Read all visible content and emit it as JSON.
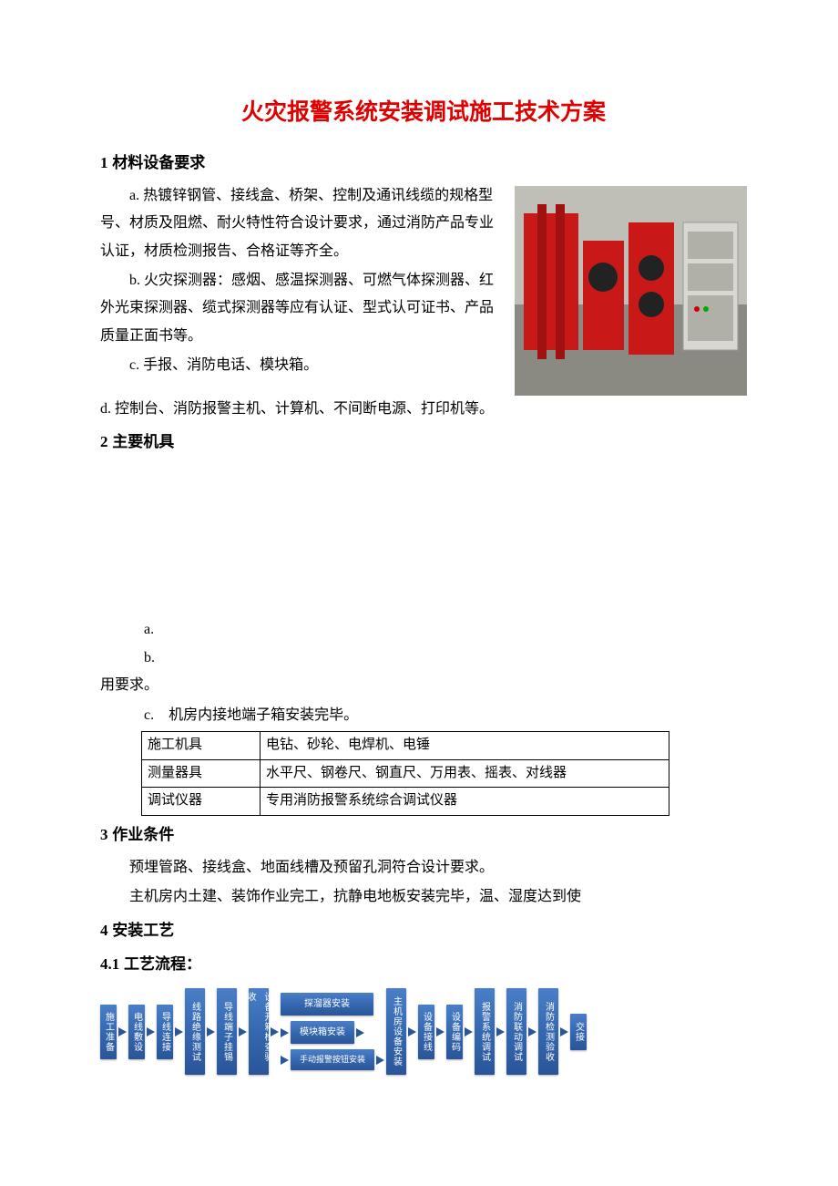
{
  "title": "火灾报警系统安装调试施工技术方案",
  "sections": {
    "s1": {
      "num": "1",
      "heading": "材料设备要求"
    },
    "s2": {
      "num": "2",
      "heading": "主要机具"
    },
    "s3": {
      "num": "3",
      "heading": "作业条件"
    },
    "s4": {
      "num": "4",
      "heading": "安装工艺"
    },
    "s4_1": {
      "num": "4.1",
      "heading": "工艺流程："
    }
  },
  "body": {
    "p_a": "a. 热镀锌钢管、接线盒、桥架、控制及通讯线缆的规格型号、材质及阻燃、耐火特性符合设计要求，通过消防产品专业认证，材质检测报告、合格证等齐全。",
    "p_b": "b. 火灾探测器：感烟、感温探测器、可燃气体探测器、红外光束探测器、缆式探测器等应有认证、型式认可证书、产品质量正面书等。",
    "p_c": "c. 手报、消防电话、模块箱。",
    "p_d": "d. 控制台、消防报警主机、计算机、不间断电源、打印机等。",
    "p_e": "a.",
    "p_f": "b.",
    "p_use": "用要求。",
    "p_g": "c.　机房内接地端子箱安装完毕。",
    "p_h": "预埋管路、接线盒、地面线槽及预留孔洞符合设计要求。",
    "p_i": "主机房内土建、装饰作业完工，抗静电地板安装完毕，温、湿度达到使"
  },
  "tool_table": {
    "rows": [
      {
        "label": "施工机具",
        "value": "电钻、砂轮、电焊机、电锤"
      },
      {
        "label": "测量器具",
        "value": "水平尺、钢卷尺、钢直尺、万用表、摇表、对线器"
      },
      {
        "label": "调试仪器",
        "value": "专用消防报警系统综合调试仪器"
      }
    ]
  },
  "flowchart": {
    "n1": "施工准备",
    "n2": "电线敷设",
    "n3": "导线连接",
    "n4": "线路绝缘测试",
    "n5": "导线端子挂锡",
    "n6": "设备开箱检查验收",
    "mid1": "探溜器安装",
    "mid2": "模块箱安装",
    "mid3": "手动报警按钮安装",
    "n7": "主机房设备安装",
    "n8": "设备接线",
    "n9": "设备编码",
    "n10": "报警系统调试",
    "n11": "消防联动调试",
    "n12": "消防检测验收",
    "n13": "交接"
  },
  "image_alt": "fire-pump-room-photo"
}
